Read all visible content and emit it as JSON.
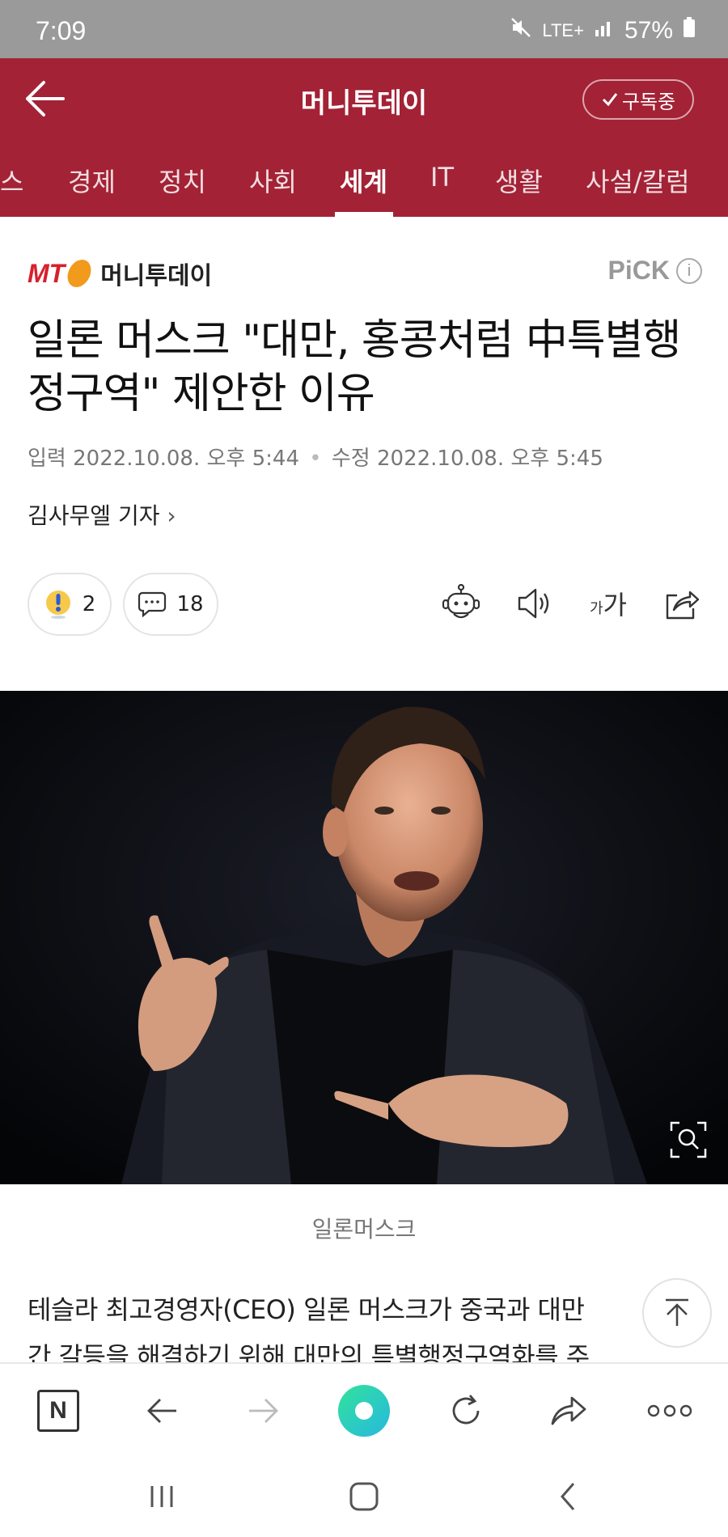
{
  "status_bar": {
    "time": "7:09",
    "network": "LTE+",
    "battery": "57%"
  },
  "header": {
    "title": "머니투데이",
    "subscribe_label": "구독중"
  },
  "categories": {
    "items": [
      "스",
      "경제",
      "정치",
      "사회",
      "세계",
      "IT",
      "생활",
      "사설/칼럼"
    ],
    "active": "세계"
  },
  "brand": {
    "logo_text": "MT",
    "name": "머니투데이",
    "pick_label": "PiCK",
    "pick_info": "i"
  },
  "article": {
    "headline": "일론 머스크 \"대만, 홍콩처럼 中특별행정구역\" 제안한 이유",
    "input_label": "입력",
    "input_date": "2022.10.08. 오후 5:44",
    "separator": "•",
    "edit_label": "수정",
    "edit_date": "2022.10.08. 오후 5:45",
    "author": "김사무엘 기자",
    "author_chevron": "›",
    "reaction_count": "2",
    "comment_count": "18",
    "font_size_small": "가",
    "font_size_large": "가",
    "photo_caption": "일론머스크",
    "body_line1": "테슬라 최고경영자(CEO) 일론 머스크가 중국과 대만",
    "body_line2": "간 갈등을 해결하기 위해 대만의 특별행정구역화를 주"
  },
  "icons": {
    "back": "back-arrow-icon",
    "check": "check-icon",
    "reaction": "exclamation-bubble-icon",
    "comment": "comment-icon",
    "robot": "robot-summary-icon",
    "speaker": "speaker-icon",
    "share": "share-icon",
    "zoom": "zoom-image-icon",
    "scroll_top": "arrow-up-icon"
  },
  "browser_bar": {
    "home_letter": "N"
  },
  "colors": {
    "brand_red": "#a32236",
    "logo_red": "#d7202d",
    "logo_orange": "#f29a1b",
    "reload_green": "#2fd3a0"
  }
}
